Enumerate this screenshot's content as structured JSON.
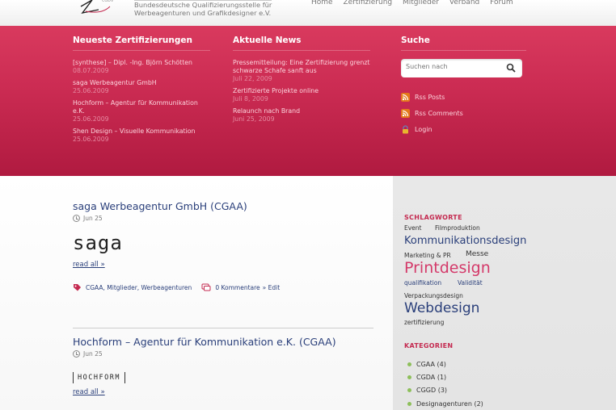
{
  "header": {
    "logo_subtitle_line1": "Bundesdeutsche Qualifizierungsstelle für",
    "logo_subtitle_line2": "Werbeagenturen und Grafikdesigner e.V.",
    "nav": [
      "Home",
      "Zertifizierung",
      "Mitglieder",
      "Verband",
      "Forum"
    ]
  },
  "banner": {
    "certifications": {
      "title": "Neueste Zertifizierungen",
      "items": [
        {
          "title": "[synthese] – Dipl. -Ing. Björn Schötten",
          "date": "08.07.2009"
        },
        {
          "title": "saga Werbeagentur GmbH",
          "date": "25.06.2009"
        },
        {
          "title": "Hochform – Agentur für Kommunikation e.K.",
          "date": "25.06.2009"
        },
        {
          "title": "Shen Design – Visuelle Kommunikation",
          "date": "25.06.2009"
        }
      ]
    },
    "news": {
      "title": "Aktuelle News",
      "items": [
        {
          "title": "Pressemitteilung: Eine Zertifizierung grenzt schwarze Schafe sanft aus",
          "date": "Juli 22, 2009"
        },
        {
          "title": "Zertifizierte Projekte online",
          "date": "Juli 8, 2009"
        },
        {
          "title": "Relaunch nach Brand",
          "date": "Juni 25, 2009"
        }
      ]
    },
    "search": {
      "title": "Suche",
      "placeholder": "Suchen nach",
      "links": [
        "Rss Posts",
        "Rss Comments",
        "Login"
      ]
    }
  },
  "posts": [
    {
      "title": "saga Werbeagentur GmbH (CGAA)",
      "date": "Jun 25",
      "logo_text": "saga",
      "read_all": "read all »",
      "categories": "CGAA, Mitglieder, Werbeagenturen",
      "comments": "0 Kommentare",
      "edit": "» Edit"
    },
    {
      "title": "Hochform – Agentur für Kommunikation e.K. (CGAA)",
      "date": "Jun 25",
      "logo_text": "HOCHFORM",
      "read_all": "read all »"
    }
  ],
  "sidebar": {
    "tags_title": "SCHLAGWORTE",
    "tags": [
      {
        "label": "Event",
        "color": "#333333"
      },
      {
        "label": "Filmproduktion",
        "color": "#333333"
      },
      {
        "label": "Kommunikationsdesign",
        "color": "#2a3f7a"
      },
      {
        "label": "Marketing & PR",
        "color": "#333333"
      },
      {
        "label": "Messe",
        "color": "#333333"
      },
      {
        "label": "Printdesign",
        "color": "#d43a6a"
      },
      {
        "label": "qualifikation",
        "color": "#2a3f7a"
      },
      {
        "label": "Validität",
        "color": "#2a3f7a"
      },
      {
        "label": "Verpackungsdesign",
        "color": "#333333"
      },
      {
        "label": "Webdesign",
        "color": "#2a3f7a"
      },
      {
        "label": "zertifizierung",
        "color": "#333333"
      }
    ],
    "categories_title": "KATEGORIEN",
    "categories": [
      {
        "name": "CGAA",
        "count": "(4)"
      },
      {
        "name": "CGDA",
        "count": "(1)"
      },
      {
        "name": "CGGD",
        "count": "(3)"
      },
      {
        "name": "Designagenturen",
        "count": "(2)"
      }
    ]
  },
  "colors": {
    "brand_red": "#cc2c53",
    "link_blue": "#2a3f7a",
    "accent_green": "#8dbf5a"
  }
}
